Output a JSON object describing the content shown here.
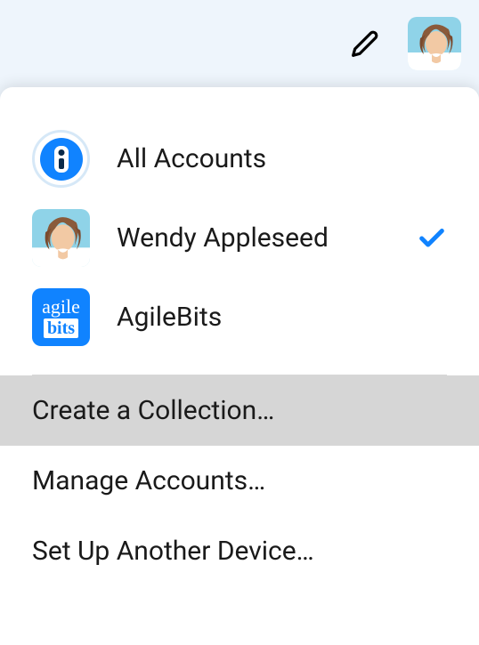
{
  "topbar": {
    "edit_icon": "pencil-icon",
    "profile_name": "Wendy Appleseed"
  },
  "accounts": [
    {
      "id": "all",
      "label": "All Accounts",
      "icon": "onepassword-icon",
      "selected": false
    },
    {
      "id": "wendy",
      "label": "Wendy Appleseed",
      "icon": "avatar-wendy",
      "selected": true
    },
    {
      "id": "agilebits",
      "label": "AgileBits",
      "icon": "agilebits-icon",
      "selected": false
    }
  ],
  "menu": {
    "create_collection": "Create a Collection…",
    "manage_accounts": "Manage Accounts…",
    "setup_device": "Set Up Another Device…"
  },
  "colors": {
    "accent": "#1083ff",
    "background_top": "#eef5fc",
    "panel": "#ffffff",
    "hover": "#d6d6d6"
  }
}
